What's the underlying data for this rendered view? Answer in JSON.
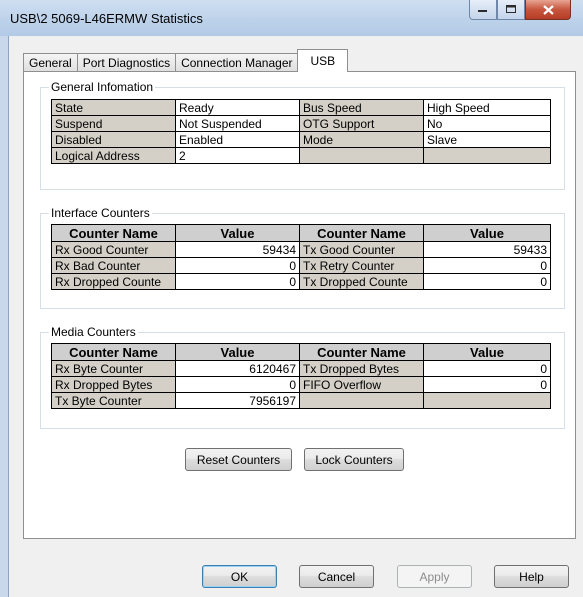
{
  "window": {
    "title": "USB\\2 5069-L46ERMW Statistics",
    "controls": {
      "minimize": "minimize-icon",
      "maximize": "maximize-icon",
      "close": "close-icon"
    }
  },
  "tabs": [
    "General",
    "Port Diagnostics",
    "Connection Manager",
    "USB"
  ],
  "active_tab": "USB",
  "general_info": {
    "title": "General Infomation",
    "rows": [
      [
        "State",
        "Ready",
        "Bus Speed",
        "High Speed"
      ],
      [
        "Suspend",
        "Not Suspended",
        "OTG Support",
        "No"
      ],
      [
        "Disabled",
        "Enabled",
        "Mode",
        "Slave"
      ],
      [
        "Logical Address",
        "2",
        "",
        ""
      ]
    ]
  },
  "interface_counters": {
    "title": "Interface Counters",
    "headers": [
      "Counter Name",
      "Value",
      "Counter Name",
      "Value"
    ],
    "rows": [
      [
        "Rx Good Counter",
        "59434",
        "Tx Good Counter",
        "59433"
      ],
      [
        "Rx Bad Counter",
        "0",
        "Tx Retry Counter",
        "0"
      ],
      [
        "Rx Dropped Counte",
        "0",
        "Tx Dropped Counte",
        "0"
      ]
    ]
  },
  "media_counters": {
    "title": "Media Counters",
    "headers": [
      "Counter Name",
      "Value",
      "Counter Name",
      "Value"
    ],
    "rows": [
      [
        "Rx Byte Counter",
        "6120467",
        "Tx Dropped Bytes",
        "0"
      ],
      [
        "Rx Dropped Bytes",
        "0",
        "FIFO Overflow",
        "0"
      ],
      [
        "Tx Byte Counter",
        "7956197",
        "",
        ""
      ]
    ]
  },
  "buttons": {
    "reset": "Reset Counters",
    "lock": "Lock Counters",
    "ok": "OK",
    "cancel": "Cancel",
    "apply": "Apply",
    "help": "Help"
  }
}
